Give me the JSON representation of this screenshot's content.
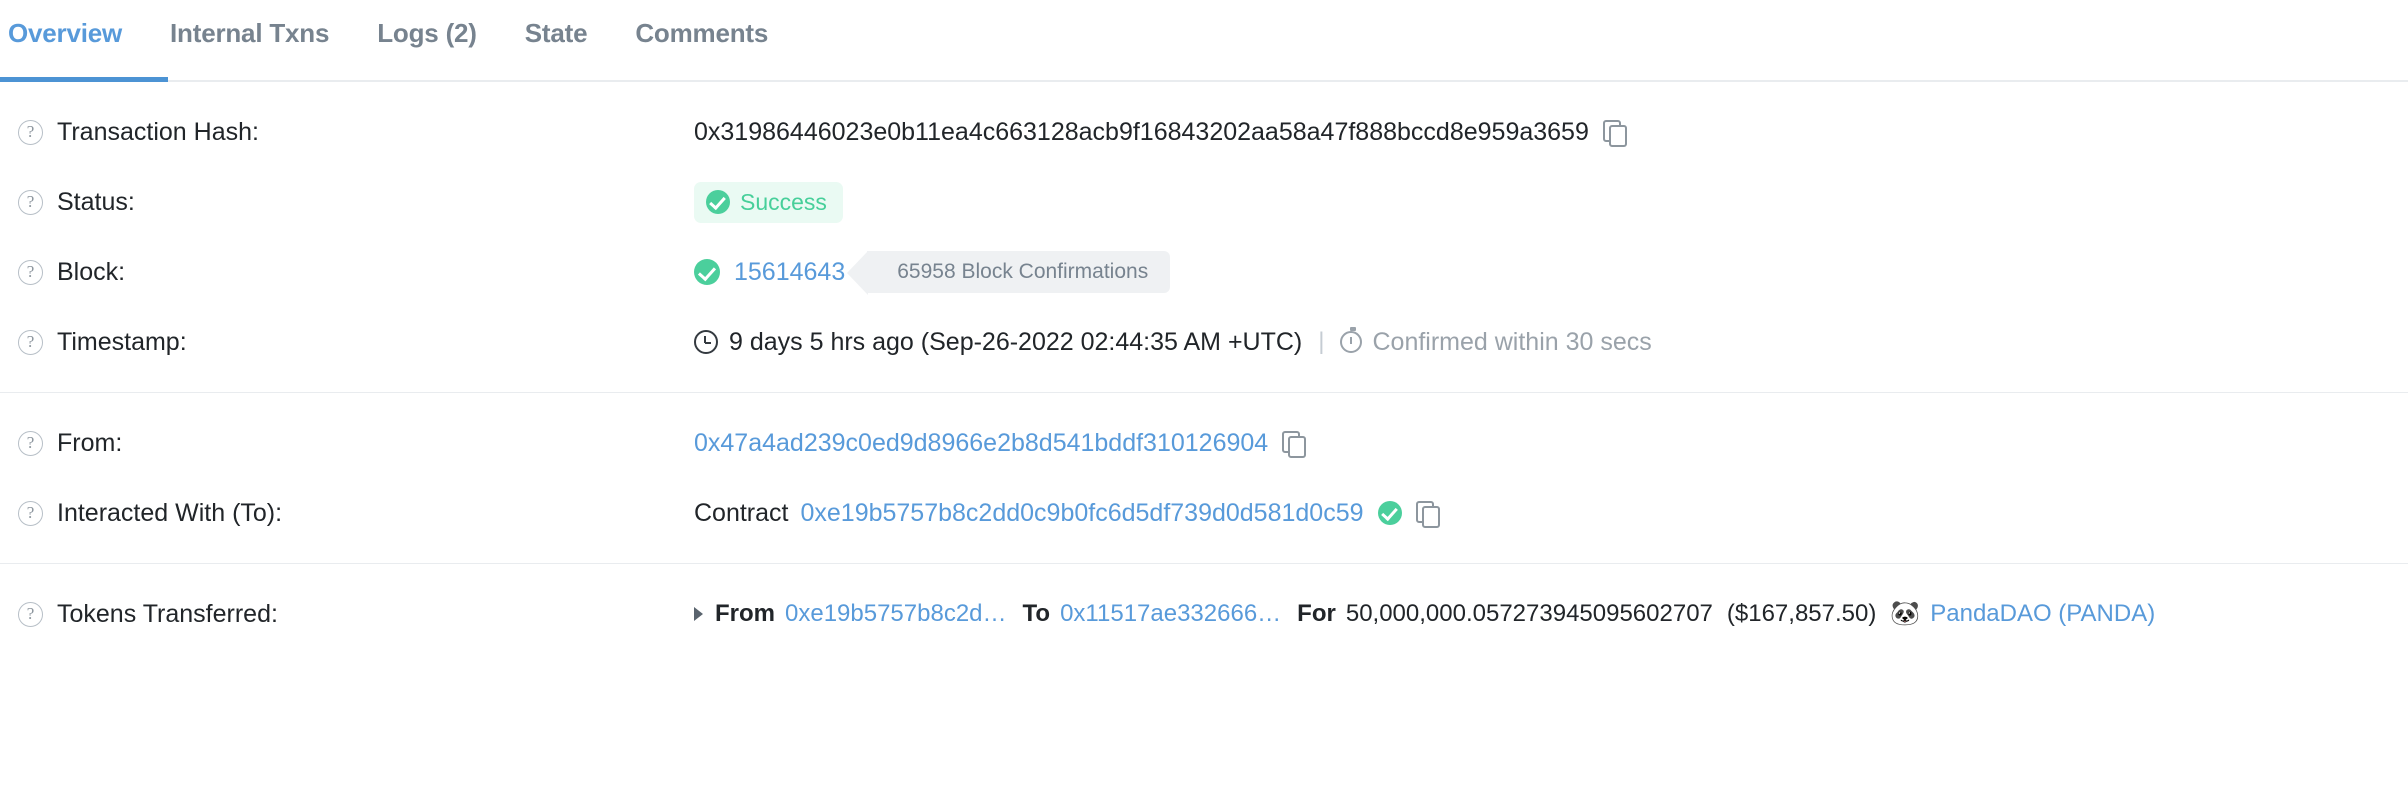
{
  "tabs": [
    {
      "label": "Overview",
      "active": true
    },
    {
      "label": "Internal Txns",
      "active": false
    },
    {
      "label": "Logs (2)",
      "active": false
    },
    {
      "label": "State",
      "active": false
    },
    {
      "label": "Comments",
      "active": false
    }
  ],
  "colors": {
    "link_blue": "#589ada",
    "active_tab_underline": "#4c93d4",
    "success_green": "#47cf9a",
    "success_bg": "#eafaf3",
    "muted_gray": "#77838f",
    "badge_gray_bg": "#eff1f3"
  },
  "rows": {
    "transaction_hash": {
      "label": "Transaction Hash:",
      "value": "0x31986446023e0b11ea4c663128acb9f16843202aa58a47f888bccd8e959a3659"
    },
    "status": {
      "label": "Status:",
      "value": "Success"
    },
    "block": {
      "label": "Block:",
      "number": "15614643",
      "confirmations": "65958 Block Confirmations"
    },
    "timestamp": {
      "label": "Timestamp:",
      "value": "9 days 5 hrs ago (Sep-26-2022 02:44:35 AM +UTC)",
      "separator": "|",
      "confirmed_note": "Confirmed within 30 secs"
    },
    "from": {
      "label": "From:",
      "address": "0x47a4ad239c0ed9d8966e2b8d541bddf310126904"
    },
    "interacted_with": {
      "label": "Interacted With (To):",
      "prefix": "Contract",
      "address": "0xe19b5757b8c2dd0c9b0fc6d5df739d0d581d0c59"
    },
    "tokens_transferred": {
      "label": "Tokens Transferred:",
      "from_word": "From",
      "from_address": "0xe19b5757b8c2d…",
      "to_word": "To",
      "to_address": "0x11517ae332666…",
      "for_word": "For",
      "amount": "50,000,000.057273945095602707",
      "usd_value": "($167,857.50)",
      "token_icon": "🐼",
      "token_name": "PandaDAO (PANDA)"
    }
  },
  "icons": {
    "help": "?",
    "copy": "copy-icon",
    "check": "check-icon",
    "clock": "clock-icon",
    "stopwatch": "stopwatch-icon",
    "expand_triangle": "triangle-right-icon"
  }
}
